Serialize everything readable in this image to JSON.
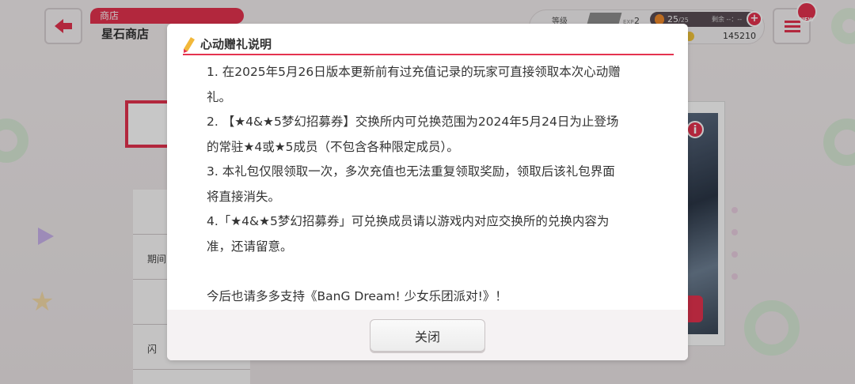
{
  "header": {
    "shop_category": "商店",
    "shop_name": "星石商店",
    "level_label": "等级",
    "exp_label": "EXP",
    "level_value": "2",
    "stamina_value": "25",
    "stamina_max": "/25",
    "recover_label": "剩余 --：--",
    "coins": "145210",
    "new_badge": "NEW"
  },
  "background": {
    "list_rows": [
      "",
      "期间",
      "",
      "闪"
    ]
  },
  "modal": {
    "title": "心动赠礼说明",
    "lines": [
      "1. 在2025年5月26日版本更新前有过充值记录的玩家可直接领取本次心动赠",
      "礼。",
      "2. 【★4&★5梦幻招募券】交换所内可兑换范围为2024年5月24日为止登场",
      "的常驻★4或★5成员（不包含各种限定成员）。",
      "3. 本礼包仅限领取一次，多次充值也无法重复领取奖励，领取后该礼包界面",
      "将直接消失。",
      "4.「★4&★5梦幻招募券」可兑换成员请以游戏内对应交换所的兑换内容为",
      "准，还请留意。"
    ],
    "closing": "今后也请多多支持《BanG Dream! 少女乐团派对!》！",
    "close_label": "关闭"
  },
  "colors": {
    "accent": "#e5334f",
    "overlay": "rgba(0,0,0,0.22)"
  }
}
